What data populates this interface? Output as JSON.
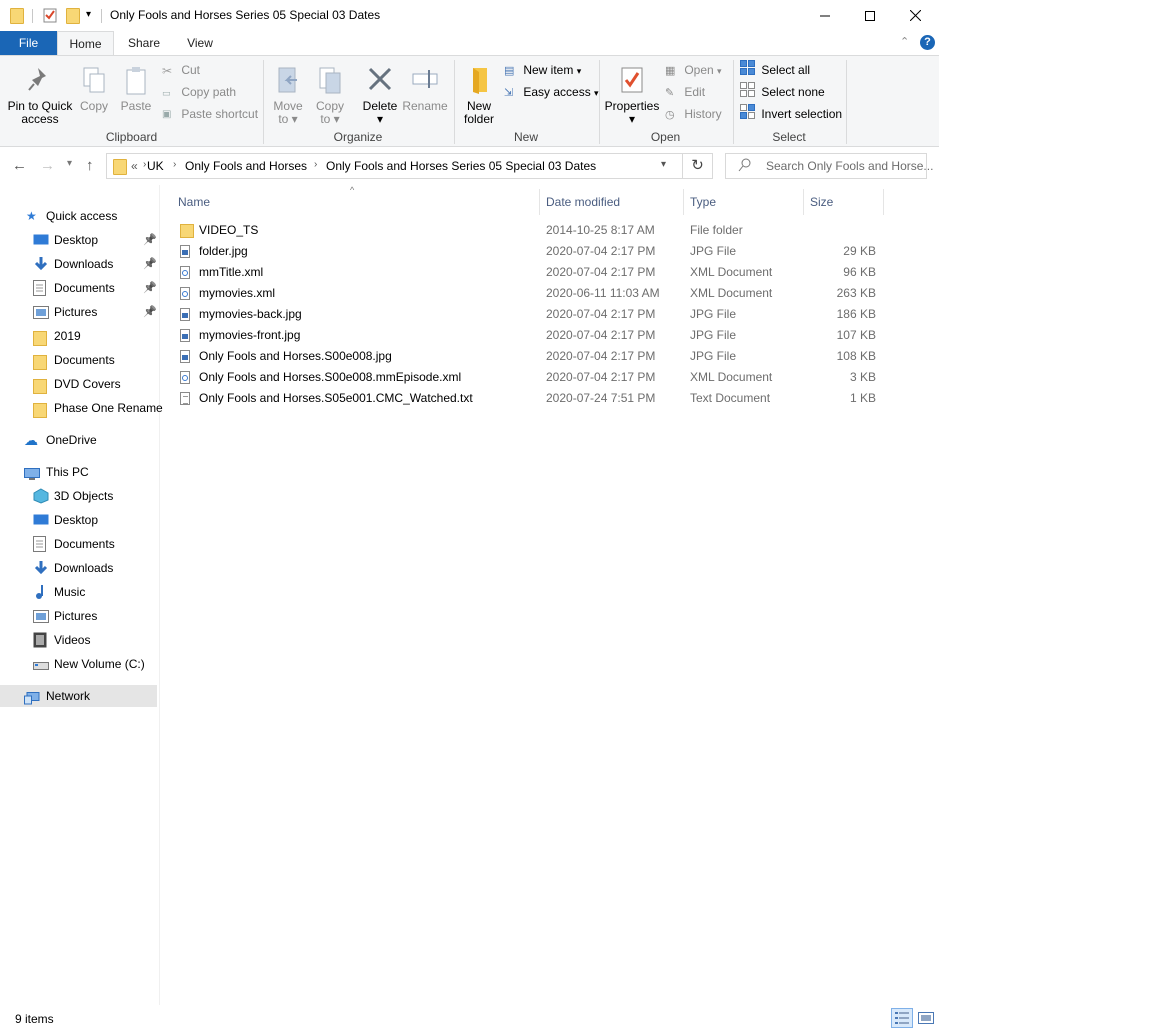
{
  "window": {
    "title": "Only Fools and Horses Series 05 Special 03 Dates"
  },
  "ribbon_tabs": [
    "File",
    "Home",
    "Share",
    "View"
  ],
  "ribbon": {
    "clipboard": {
      "pin_label": [
        "Pin to Quick",
        "access"
      ],
      "copy": "Copy",
      "paste": "Paste",
      "cut": "Cut",
      "copy_path": "Copy path",
      "paste_shortcut": "Paste shortcut",
      "group": "Clipboard"
    },
    "organize": {
      "move_to": [
        "Move",
        "to"
      ],
      "copy_to": [
        "Copy",
        "to"
      ],
      "delete": "Delete",
      "rename": "Rename",
      "group": "Organize"
    },
    "new": {
      "new_folder": [
        "New",
        "folder"
      ],
      "new_item": "New item",
      "easy_access": "Easy access",
      "group": "New"
    },
    "open": {
      "properties": "Properties",
      "open": "Open",
      "edit": "Edit",
      "history": "History",
      "group": "Open"
    },
    "select": {
      "select_all": "Select all",
      "select_none": "Select none",
      "invert": "Invert selection",
      "group": "Select"
    }
  },
  "address": {
    "prefix": "«",
    "crumbs": [
      "UK",
      "Only Fools and Horses",
      "Only Fools and Horses Series 05 Special 03 Dates"
    ],
    "search_placeholder": "Search Only Fools and Horse..."
  },
  "nav_pane": {
    "quick_access": "Quick access",
    "quick_items": [
      {
        "label": "Desktop",
        "icon": "desktop-icon",
        "pinned": true
      },
      {
        "label": "Downloads",
        "icon": "download-icon",
        "pinned": true
      },
      {
        "label": "Documents",
        "icon": "documents-icon",
        "pinned": true
      },
      {
        "label": "Pictures",
        "icon": "pictures-icon",
        "pinned": true
      },
      {
        "label": "2019",
        "icon": "folder-icon",
        "pinned": false
      },
      {
        "label": "Documents",
        "icon": "folder-icon",
        "pinned": false
      },
      {
        "label": "DVD Covers",
        "icon": "folder-icon",
        "pinned": false
      },
      {
        "label": "Phase One Rename",
        "icon": "folder-icon",
        "pinned": false
      }
    ],
    "onedrive": "OneDrive",
    "this_pc": "This PC",
    "pc_items": [
      {
        "label": "3D Objects",
        "icon": "cube-icon"
      },
      {
        "label": "Desktop",
        "icon": "desktop-icon"
      },
      {
        "label": "Documents",
        "icon": "documents-icon"
      },
      {
        "label": "Downloads",
        "icon": "download-icon"
      },
      {
        "label": "Music",
        "icon": "music-icon"
      },
      {
        "label": "Pictures",
        "icon": "pictures-icon"
      },
      {
        "label": "Videos",
        "icon": "video-icon"
      },
      {
        "label": "New Volume (C:)",
        "icon": "drive-icon"
      }
    ],
    "network": "Network"
  },
  "columns": {
    "name": "Name",
    "date": "Date modified",
    "type": "Type",
    "size": "Size"
  },
  "files": [
    {
      "name": "VIDEO_TS",
      "date": "2014-10-25 8:17 AM",
      "type": "File folder",
      "size": "",
      "kind": "folder"
    },
    {
      "name": "folder.jpg",
      "date": "2020-07-04 2:17 PM",
      "type": "JPG File",
      "size": "29 KB",
      "kind": "img"
    },
    {
      "name": "mmTitle.xml",
      "date": "2020-07-04 2:17 PM",
      "type": "XML Document",
      "size": "96 KB",
      "kind": "xml"
    },
    {
      "name": "mymovies.xml",
      "date": "2020-06-11 11:03 AM",
      "type": "XML Document",
      "size": "263 KB",
      "kind": "xml"
    },
    {
      "name": "mymovies-back.jpg",
      "date": "2020-07-04 2:17 PM",
      "type": "JPG File",
      "size": "186 KB",
      "kind": "img"
    },
    {
      "name": "mymovies-front.jpg",
      "date": "2020-07-04 2:17 PM",
      "type": "JPG File",
      "size": "107 KB",
      "kind": "img"
    },
    {
      "name": "Only Fools and Horses.S00e008.jpg",
      "date": "2020-07-04 2:17 PM",
      "type": "JPG File",
      "size": "108 KB",
      "kind": "img"
    },
    {
      "name": "Only Fools and Horses.S00e008.mmEpisode.xml",
      "date": "2020-07-04 2:17 PM",
      "type": "XML Document",
      "size": "3 KB",
      "kind": "xml"
    },
    {
      "name": "Only Fools and Horses.S05e001.CMC_Watched.txt",
      "date": "2020-07-24 7:51 PM",
      "type": "Text Document",
      "size": "1 KB",
      "kind": "txt"
    }
  ],
  "status": {
    "count": "9 items"
  },
  "colors": {
    "accent": "#1a66b6",
    "selected": "#e5e5e5",
    "folder": "#f8d775"
  }
}
